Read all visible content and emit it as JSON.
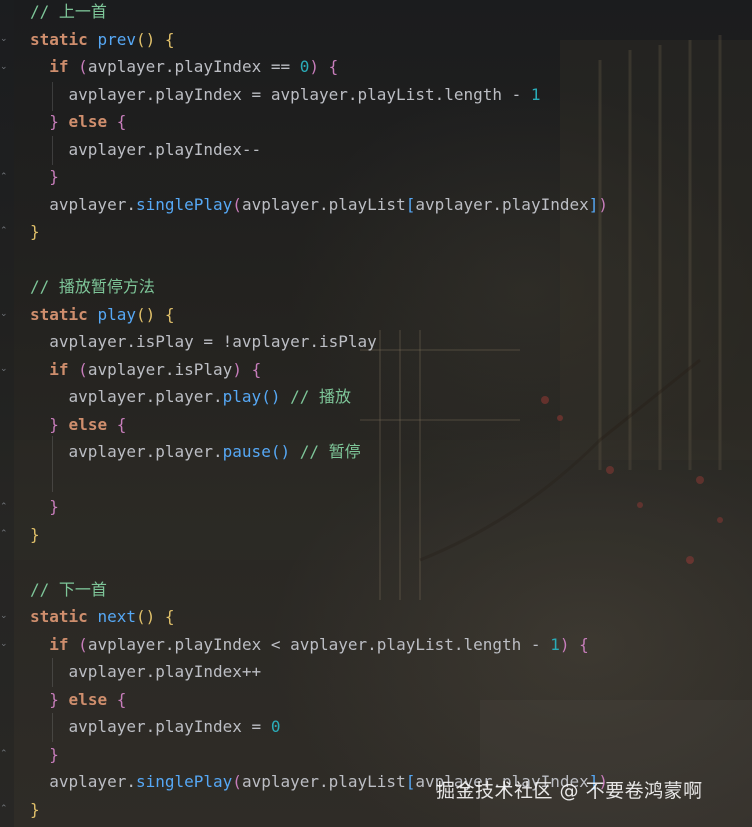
{
  "editor": {
    "watermark": "掘金技术社区 @ 不要卷鸿蒙啊",
    "colors": {
      "keyword": "#cf8e6d",
      "function": "#56a8f5",
      "identifier": "#bcbec4",
      "number": "#2aacb8",
      "comment": "#7ec699"
    },
    "lines": [
      [
        {
          "t": "// 上一首",
          "c": "cmt"
        }
      ],
      [
        {
          "t": "static",
          "c": "kw"
        },
        {
          "t": " "
        },
        {
          "t": "prev",
          "c": "fn"
        },
        {
          "t": "()",
          "c": "p1"
        },
        {
          "t": " "
        },
        {
          "t": "{",
          "c": "p1"
        }
      ],
      [
        {
          "t": "  "
        },
        {
          "t": "if",
          "c": "kw"
        },
        {
          "t": " "
        },
        {
          "t": "(",
          "c": "p2"
        },
        {
          "t": "avplayer.playIndex == "
        },
        {
          "t": "0",
          "c": "num"
        },
        {
          "t": ")",
          "c": "p2"
        },
        {
          "t": " "
        },
        {
          "t": "{",
          "c": "p2"
        }
      ],
      [
        {
          "t": "    avplayer.playIndex = avplayer.playList.length - "
        },
        {
          "t": "1",
          "c": "num"
        }
      ],
      [
        {
          "t": "  "
        },
        {
          "t": "}",
          "c": "p2"
        },
        {
          "t": " "
        },
        {
          "t": "else",
          "c": "kw"
        },
        {
          "t": " "
        },
        {
          "t": "{",
          "c": "p2"
        }
      ],
      [
        {
          "t": "    avplayer.playIndex--"
        }
      ],
      [
        {
          "t": "  "
        },
        {
          "t": "}",
          "c": "p2"
        }
      ],
      [
        {
          "t": "  avplayer."
        },
        {
          "t": "singlePlay",
          "c": "fn"
        },
        {
          "t": "(",
          "c": "p2"
        },
        {
          "t": "avplayer.playList"
        },
        {
          "t": "[",
          "c": "p3"
        },
        {
          "t": "avplayer.playIndex"
        },
        {
          "t": "]",
          "c": "p3"
        },
        {
          "t": ")",
          "c": "p2"
        }
      ],
      [
        {
          "t": "}",
          "c": "p1"
        }
      ],
      [],
      [
        {
          "t": "// 播放暂停方法",
          "c": "cmt"
        }
      ],
      [
        {
          "t": "static",
          "c": "kw"
        },
        {
          "t": " "
        },
        {
          "t": "play",
          "c": "fn"
        },
        {
          "t": "()",
          "c": "p1"
        },
        {
          "t": " "
        },
        {
          "t": "{",
          "c": "p1"
        }
      ],
      [
        {
          "t": "  avplayer.isPlay = !avplayer.isPlay"
        }
      ],
      [
        {
          "t": "  "
        },
        {
          "t": "if",
          "c": "kw"
        },
        {
          "t": " "
        },
        {
          "t": "(",
          "c": "p2"
        },
        {
          "t": "avplayer.isPlay"
        },
        {
          "t": ")",
          "c": "p2"
        },
        {
          "t": " "
        },
        {
          "t": "{",
          "c": "p2"
        }
      ],
      [
        {
          "t": "    avplayer.player."
        },
        {
          "t": "play",
          "c": "fn"
        },
        {
          "t": "()",
          "c": "p3"
        },
        {
          "t": " "
        },
        {
          "t": "// 播放",
          "c": "cmt"
        }
      ],
      [
        {
          "t": "  "
        },
        {
          "t": "}",
          "c": "p2"
        },
        {
          "t": " "
        },
        {
          "t": "else",
          "c": "kw"
        },
        {
          "t": " "
        },
        {
          "t": "{",
          "c": "p2"
        }
      ],
      [
        {
          "t": "    avplayer.player."
        },
        {
          "t": "pause",
          "c": "fn"
        },
        {
          "t": "()",
          "c": "p3"
        },
        {
          "t": " "
        },
        {
          "t": "// 暂停",
          "c": "cmt"
        }
      ],
      [],
      [
        {
          "t": "  "
        },
        {
          "t": "}",
          "c": "p2"
        }
      ],
      [
        {
          "t": "}",
          "c": "p1"
        }
      ],
      [],
      [
        {
          "t": "// 下一首",
          "c": "cmt"
        }
      ],
      [
        {
          "t": "static",
          "c": "kw"
        },
        {
          "t": " "
        },
        {
          "t": "next",
          "c": "fn"
        },
        {
          "t": "()",
          "c": "p1"
        },
        {
          "t": " "
        },
        {
          "t": "{",
          "c": "p1"
        }
      ],
      [
        {
          "t": "  "
        },
        {
          "t": "if",
          "c": "kw"
        },
        {
          "t": " "
        },
        {
          "t": "(",
          "c": "p2"
        },
        {
          "t": "avplayer.playIndex < avplayer.playList.length - "
        },
        {
          "t": "1",
          "c": "num"
        },
        {
          "t": ")",
          "c": "p2"
        },
        {
          "t": " "
        },
        {
          "t": "{",
          "c": "p2"
        }
      ],
      [
        {
          "t": "    avplayer.playIndex++"
        }
      ],
      [
        {
          "t": "  "
        },
        {
          "t": "}",
          "c": "p2"
        },
        {
          "t": " "
        },
        {
          "t": "else",
          "c": "kw"
        },
        {
          "t": " "
        },
        {
          "t": "{",
          "c": "p2"
        }
      ],
      [
        {
          "t": "    avplayer.playIndex = "
        },
        {
          "t": "0",
          "c": "num"
        }
      ],
      [
        {
          "t": "  "
        },
        {
          "t": "}",
          "c": "p2"
        }
      ],
      [
        {
          "t": "  avplayer."
        },
        {
          "t": "singlePlay",
          "c": "fn"
        },
        {
          "t": "(",
          "c": "p2"
        },
        {
          "t": "avplayer.playList"
        },
        {
          "t": "[",
          "c": "p3"
        },
        {
          "t": "avplayer.playIndex"
        },
        {
          "t": "]",
          "c": "p3"
        },
        {
          "t": ")",
          "c": "p2"
        }
      ],
      [
        {
          "t": "}",
          "c": "p1"
        }
      ]
    ]
  }
}
